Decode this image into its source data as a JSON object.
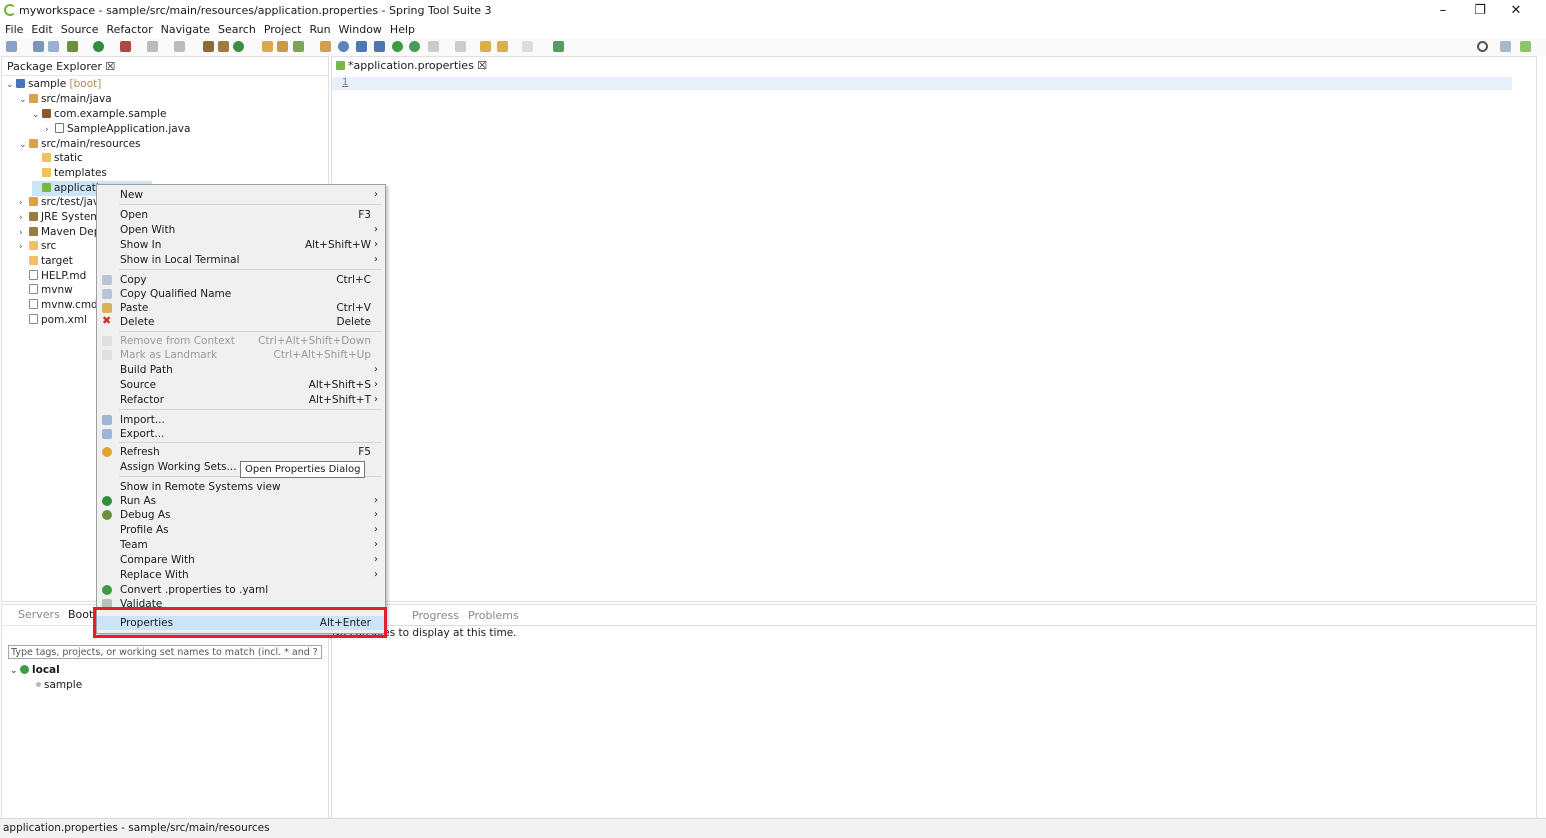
{
  "window": {
    "title": "myworkspace - sample/src/main/resources/application.properties - Spring Tool Suite 3",
    "minimize": "–",
    "restore": "❐",
    "close": "✕"
  },
  "menubar": [
    "File",
    "Edit",
    "Source",
    "Refactor",
    "Navigate",
    "Search",
    "Project",
    "Run",
    "Window",
    "Help"
  ],
  "package_explorer": {
    "title": "Package Explorer ☒",
    "tree": [
      {
        "twisty": "⌄",
        "icon": "project",
        "label": "sample",
        "suffix": "[boot]"
      },
      {
        "twisty": "⌄",
        "icon": "src-folder",
        "label": "src/main/java"
      },
      {
        "twisty": "⌄",
        "icon": "package",
        "label": "com.example.sample"
      },
      {
        "twisty": "›",
        "icon": "java-file",
        "label": "SampleApplication.java"
      },
      {
        "twisty": "⌄",
        "icon": "src-folder",
        "label": "src/main/resources"
      },
      {
        "twisty": "",
        "icon": "folder",
        "label": "static"
      },
      {
        "twisty": "",
        "icon": "folder",
        "label": "templates"
      },
      {
        "twisty": "",
        "icon": "properties-file",
        "label": "applicati"
      },
      {
        "twisty": "›",
        "icon": "src-folder",
        "label": "src/test/java"
      },
      {
        "twisty": "›",
        "icon": "library",
        "label": "JRE System"
      },
      {
        "twisty": "›",
        "icon": "library",
        "label": "Maven Dep"
      },
      {
        "twisty": "›",
        "icon": "folder",
        "label": "src"
      },
      {
        "twisty": "",
        "icon": "folder",
        "label": "target"
      },
      {
        "twisty": "",
        "icon": "file",
        "label": "HELP.md"
      },
      {
        "twisty": "",
        "icon": "file",
        "label": "mvnw"
      },
      {
        "twisty": "",
        "icon": "file",
        "label": "mvnw.cmd"
      },
      {
        "twisty": "",
        "icon": "file",
        "label": "pom.xml"
      }
    ]
  },
  "editor": {
    "tab": "*application.properties ☒",
    "line_number": "1"
  },
  "boot_dashboard": {
    "tab_servers": "Servers",
    "tab_boot": "Boot",
    "filter_placeholder": "Type tags, projects, or working set names to match (incl. * and ? wildca",
    "group": "local",
    "app": "sample"
  },
  "console": {
    "tab_progress": "Progress",
    "tab_problems": "Problems",
    "message": "No consoles to display at this time."
  },
  "status_bar": "application.properties - sample/src/main/resources",
  "context_menu": {
    "items": [
      {
        "label": "New",
        "shortcut": "",
        "submenu": true
      },
      {
        "label": "Open",
        "shortcut": "F3",
        "submenu": false
      },
      {
        "label": "Open With",
        "shortcut": "",
        "submenu": true
      },
      {
        "label": "Show In",
        "shortcut": "Alt+Shift+W",
        "submenu": true
      },
      {
        "label": "Show in Local Terminal",
        "shortcut": "",
        "submenu": true
      },
      {
        "label": "Copy",
        "shortcut": "Ctrl+C",
        "submenu": false
      },
      {
        "label": "Copy Qualified Name",
        "shortcut": "",
        "submenu": false
      },
      {
        "label": "Paste",
        "shortcut": "Ctrl+V",
        "submenu": false
      },
      {
        "label": "Delete",
        "shortcut": "Delete",
        "submenu": false
      },
      {
        "label": "Remove from Context",
        "shortcut": "Ctrl+Alt+Shift+Down",
        "submenu": false,
        "disabled": true
      },
      {
        "label": "Mark as Landmark",
        "shortcut": "Ctrl+Alt+Shift+Up",
        "submenu": false,
        "disabled": true
      },
      {
        "label": "Build Path",
        "shortcut": "",
        "submenu": true
      },
      {
        "label": "Source",
        "shortcut": "Alt+Shift+S",
        "submenu": true
      },
      {
        "label": "Refactor",
        "shortcut": "Alt+Shift+T",
        "submenu": true
      },
      {
        "label": "Import...",
        "shortcut": "",
        "submenu": false
      },
      {
        "label": "Export...",
        "shortcut": "",
        "submenu": false
      },
      {
        "label": "Refresh",
        "shortcut": "F5",
        "submenu": false
      },
      {
        "label": "Assign Working Sets...",
        "shortcut": "",
        "submenu": false
      },
      {
        "label": "Show in Remote Systems view",
        "shortcut": "",
        "submenu": false
      },
      {
        "label": "Run As",
        "shortcut": "",
        "submenu": true
      },
      {
        "label": "Debug As",
        "shortcut": "",
        "submenu": true
      },
      {
        "label": "Profile As",
        "shortcut": "",
        "submenu": true
      },
      {
        "label": "Team",
        "shortcut": "",
        "submenu": true
      },
      {
        "label": "Compare With",
        "shortcut": "",
        "submenu": true
      },
      {
        "label": "Replace With",
        "shortcut": "",
        "submenu": true
      },
      {
        "label": "Convert .properties to .yaml",
        "shortcut": "",
        "submenu": false
      },
      {
        "label": "Validate",
        "shortcut": "",
        "submenu": false
      },
      {
        "label": "Properties",
        "shortcut": "Alt+Enter",
        "submenu": false,
        "selected": true
      }
    ],
    "arrow": "›"
  },
  "tooltip": "Open Properties Dialog",
  "colors": {
    "selection": "#cce4f7",
    "highlight_box": "#e0202a",
    "spring_green": "#6db33f"
  }
}
